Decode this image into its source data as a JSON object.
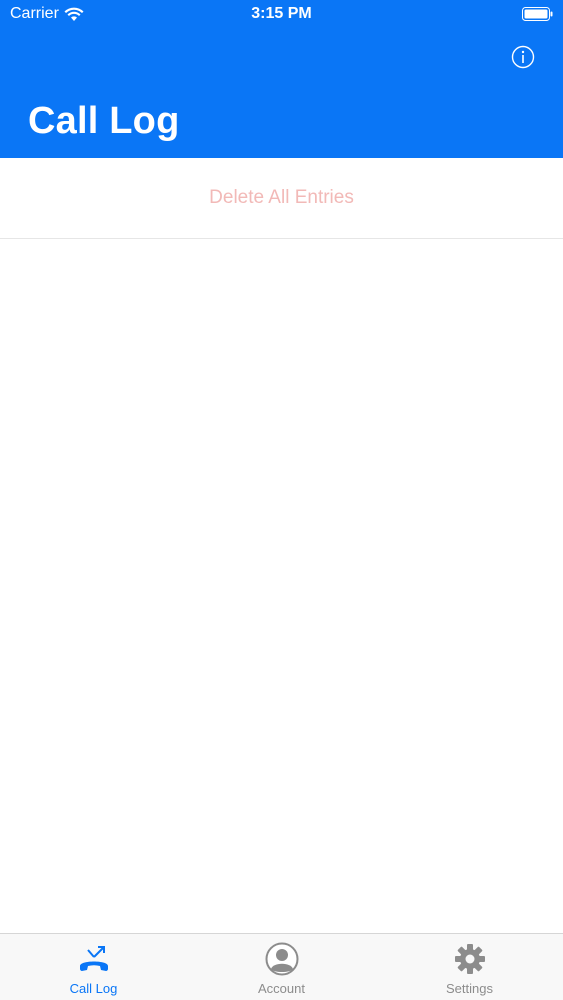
{
  "status_bar": {
    "carrier": "Carrier",
    "time": "3:15 PM",
    "wifi_icon": "wifi-icon",
    "battery_icon": "battery-icon"
  },
  "header": {
    "title": "Call Log",
    "info_icon": "info-icon",
    "background_color": "#0a76f6"
  },
  "actions": {
    "delete_all_label": "Delete All Entries",
    "delete_color": "#f2b9b7"
  },
  "tab_bar": {
    "tabs": [
      {
        "label": "Call Log",
        "icon": "phone-call-icon",
        "active": true
      },
      {
        "label": "Account",
        "icon": "account-avatar-icon",
        "active": false
      },
      {
        "label": "Settings",
        "icon": "gear-icon",
        "active": false
      }
    ],
    "active_color": "#0a76f6",
    "inactive_color": "#8c8c8c"
  }
}
